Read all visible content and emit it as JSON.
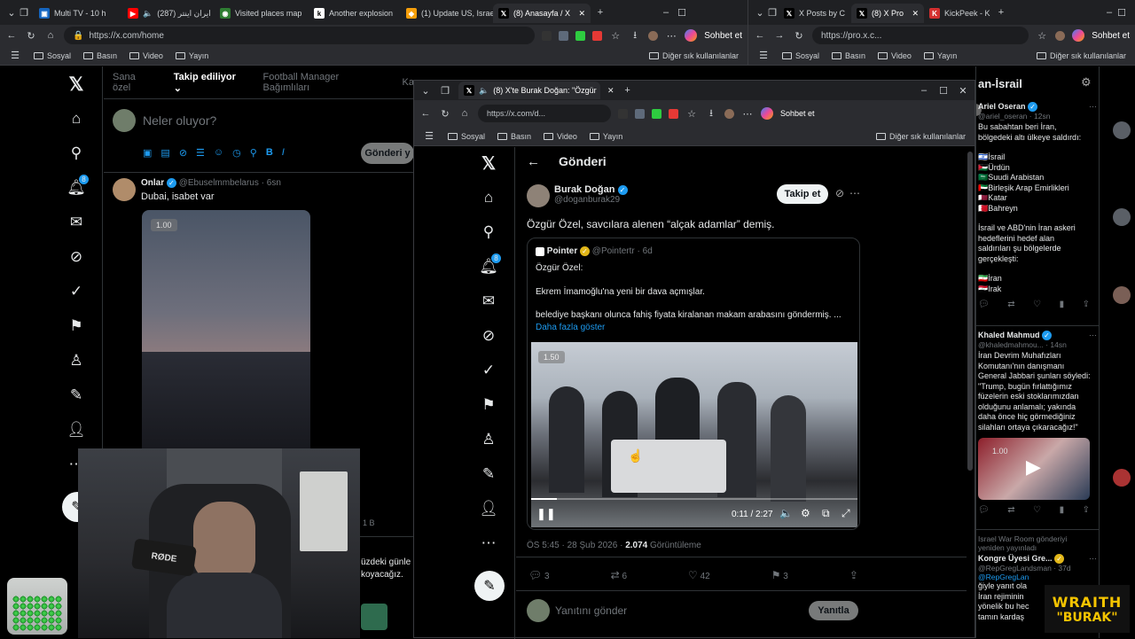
{
  "left_window": {
    "tabs": [
      {
        "label": "Multi TV - 10 h",
        "fav": "tv-icon",
        "color": "#1565c0"
      },
      {
        "label": "ایران اینتر (287)",
        "fav": "youtube-icon",
        "color": "#ff0000"
      },
      {
        "label": "Visited places map",
        "fav": "globe-icon",
        "color": "#2e7d32"
      },
      {
        "label": "Another explosion",
        "fav": "news-icon",
        "color": "#444"
      },
      {
        "label": "(1) Update US, Israe",
        "fav": "update-icon",
        "color": "#f59e0b"
      },
      {
        "label": "(8) Anasayfa / X",
        "fav": "x-icon",
        "color": "#000"
      }
    ],
    "url": "https://x.com/home",
    "chat_label": "Sohbet et",
    "bookmarks": [
      "Sosyal",
      "Basın",
      "Video",
      "Yayın"
    ],
    "other_bookmarks": "Diğer sık kullanılanlar",
    "feed_tabs": [
      "Sana özel",
      "Takip ediliyor",
      "Football Manager Bağımlıları",
      "Ka"
    ],
    "compose_placeholder": "Neler oluyor?",
    "post_button": "Gönderi y",
    "notif_badge": "8",
    "tweet": {
      "name": "Onlar",
      "handle": "@Ebuselmmbelarus",
      "time": "6sn",
      "text": "Dubai, isabet var",
      "speed": "1.00"
    },
    "partial_count": "1 B",
    "partial_text_1": "üzdeki günle",
    "partial_text_2": "koyacağız."
  },
  "right_window": {
    "tabs": [
      {
        "label": "X Posts by C",
        "fav": "x-icon"
      },
      {
        "label": "(8) X Pro",
        "fav": "x-icon"
      },
      {
        "label": "KickPeek - K",
        "fav": "kick-icon"
      }
    ],
    "url": "https://pro.x.c...",
    "chat_label": "Sohbet et",
    "bookmarks": [
      "Sosyal",
      "Basın",
      "Video",
      "Yayın"
    ],
    "other_bookmarks": "Diğer sık kullanılanlar",
    "column_title": "an-İsrail",
    "tweet1": {
      "name": "Ariel Oseran",
      "handle": "@ariel_oseran",
      "time": "12sn",
      "lines": [
        "Bu sabahtan beri İran,",
        "bölgedeki altı ülkeye saldırdı:",
        "",
        "🇮🇱İsrail",
        "🇯🇴Ürdün",
        "🇸🇦Suudi Arabistan",
        "🇦🇪Birleşik Arap Emirlikleri",
        "🇶🇦Katar",
        "🇧🇭Bahreyn",
        "",
        "İsrail ve ABD'nin İran askeri",
        "hedeflerini hedef alan",
        "saldırıları şu bölgelerde",
        "gerçekleşti:",
        "",
        "🇮🇷İran",
        "🇮🇶Irak"
      ]
    },
    "tweet2": {
      "name": "Khaled Mahmud",
      "handle": "@khaledmahmou...",
      "time": "14sn",
      "lines": [
        "İran Devrim Muhafızları",
        "Komutanı'nın danışmanı",
        "General Jabbari şunları söyledi:",
        "\"Trump, bugün fırlattığımız",
        "füzelerin eski stoklarımızdan",
        "olduğunu anlamalı; yakında",
        "daha önce hiç görmediğiniz",
        "silahları ortaya çıkaracağız!\""
      ],
      "speed": "1.00"
    },
    "tweet3": {
      "repost_line": "Israel War Room  gönderiyi",
      "repost_line2": "yeniden yayınladı",
      "name": "Kongre Üyesi Gre...",
      "handle": "@RepGregLandsman",
      "time": "37d",
      "mention": "@RepGregLan",
      "lines": [
        "ğiyle yanıt ola",
        "İran rejiminin",
        "yönelik bu hec",
        "tamın kardaş"
      ]
    }
  },
  "popup": {
    "tab_label": "(8) X'te Burak Doğan: \"Özgür",
    "url": "https://x.com/d...",
    "chat_label": "Sohbet et",
    "bookmarks": [
      "Sosyal",
      "Basın",
      "Video",
      "Yayın"
    ],
    "other_bookmarks": "Diğer sık kullanılanlar",
    "header": "Gönderi",
    "notif_badge": "8",
    "author": {
      "name": "Burak Doğan",
      "handle": "@doganburak29"
    },
    "follow_label": "Takip et",
    "text": "Özgür Özel, savcılara alenen “alçak adamlar” demiş.",
    "quote": {
      "name": "Pointer",
      "handle": "@Pointertr",
      "time": "6d",
      "line1": "Özgür Özel:",
      "line2": "Ekrem İmamoğlu'na yeni bir dava açmışlar.",
      "line3": "belediye başkanı olunca fahiş fiyata kiralanan makam arabasını göndermiş. ...",
      "show_more": "Daha fazla göster"
    },
    "video": {
      "speed": "1.50",
      "time": "0:11 / 2:27",
      "progress": 0.08
    },
    "meta": {
      "time": "ÖS 5:45 · 28 Şub 2026 · ",
      "views": "2.074",
      "views_label": " Görüntüleme"
    },
    "counts": {
      "replies": "3",
      "reposts": "6",
      "likes": "42",
      "bookmarks": "3"
    },
    "reply_placeholder": "Yanıtını gönder",
    "reply_button": "Yanıtla"
  },
  "overlay": {
    "logo_line1": "WRAITH",
    "logo_line2": "\"BURAK\"",
    "mic_brand": "RØDE"
  }
}
